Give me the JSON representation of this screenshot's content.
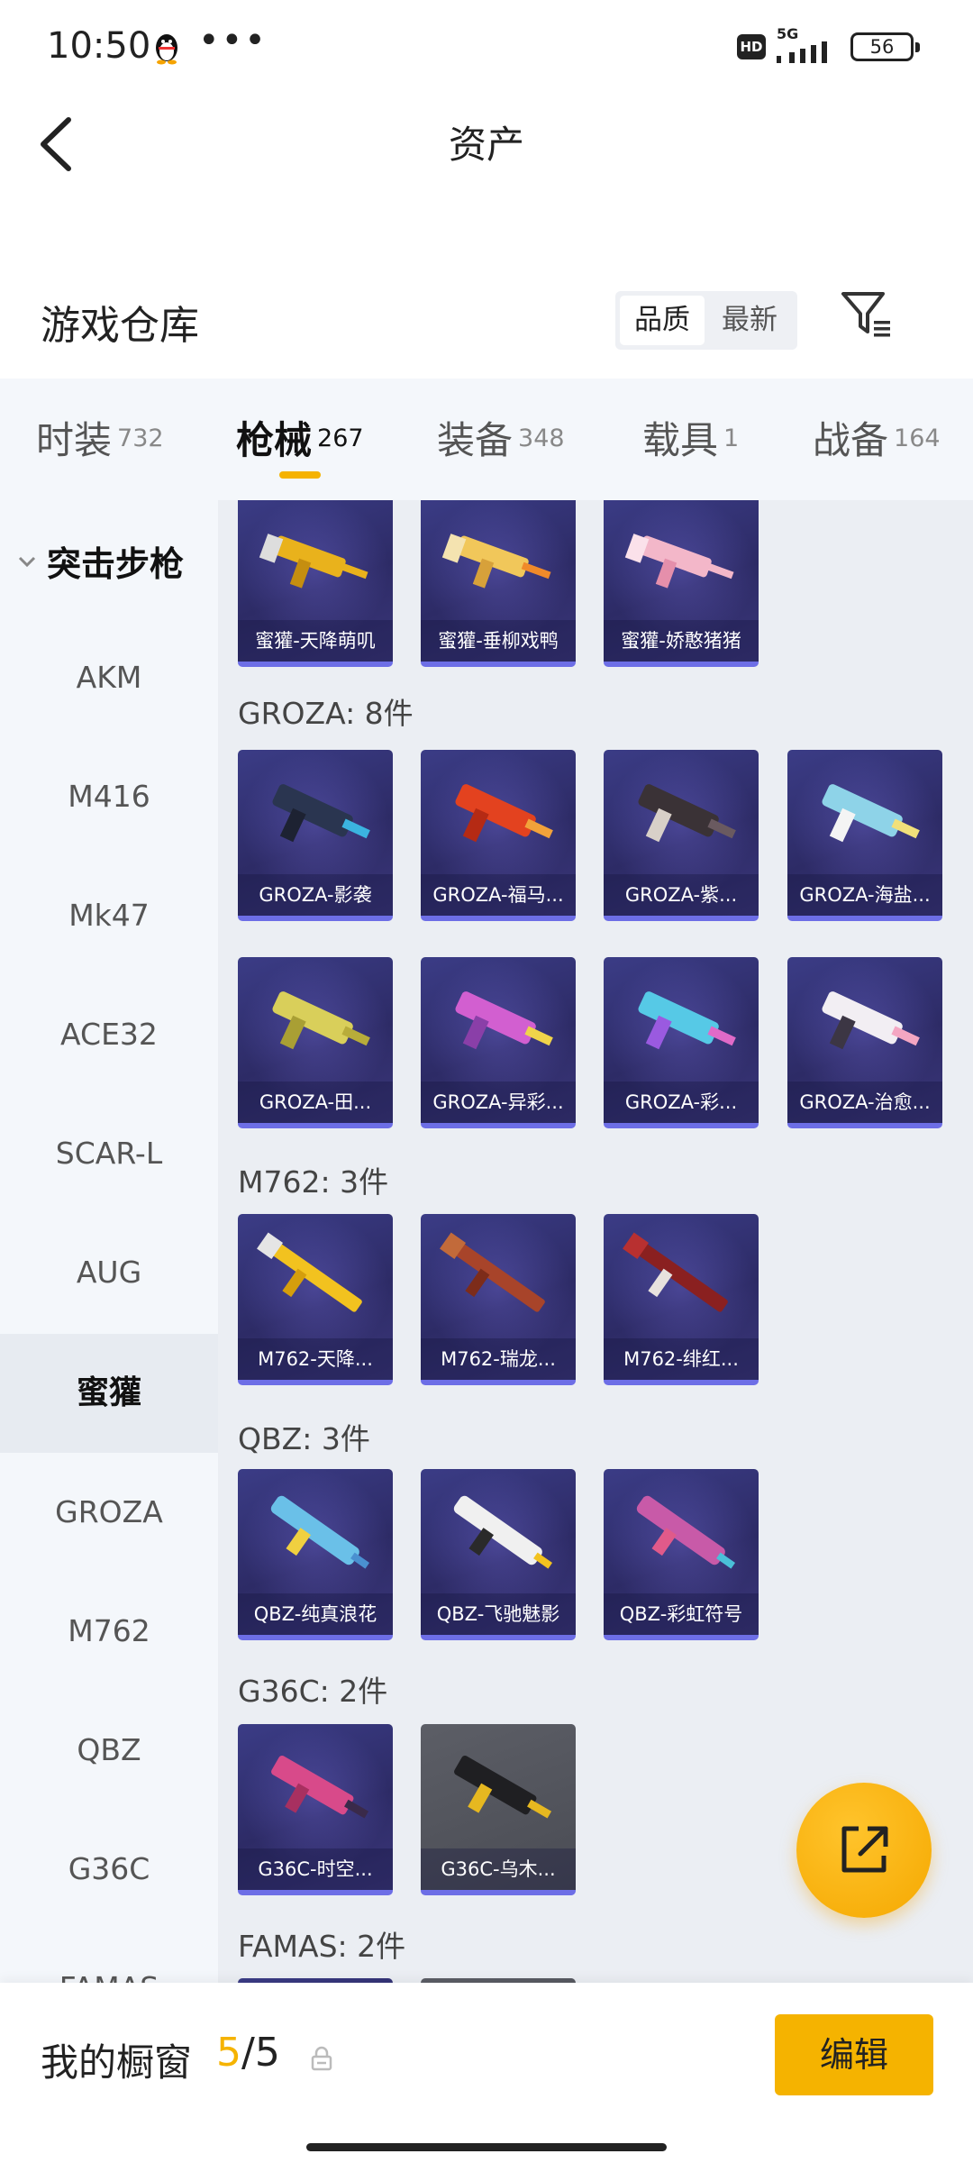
{
  "status_bar": {
    "time": "10:50",
    "hd": "HD",
    "network": "5G",
    "battery": "56"
  },
  "nav": {
    "title": "资产"
  },
  "warehouse": {
    "title": "游戏仓库",
    "sort_quality": "品质",
    "sort_newest": "最新"
  },
  "tabs": [
    {
      "label": "时装",
      "count": "732"
    },
    {
      "label": "枪械",
      "count": "267"
    },
    {
      "label": "装备",
      "count": "348"
    },
    {
      "label": "载具",
      "count": "1"
    },
    {
      "label": "战备",
      "count": "164"
    }
  ],
  "active_tab": "枪械",
  "sidebar": {
    "group": "突击步枪",
    "items": [
      "AKM",
      "M416",
      "Mk47",
      "ACE32",
      "SCAR-L",
      "AUG",
      "蜜獾",
      "GROZA",
      "M762",
      "QBZ",
      "G36C",
      "FAMAS"
    ],
    "active": "蜜獾"
  },
  "sections": {
    "honeybadger_cards": [
      "蜜獾-天降萌叽",
      "蜜獾-垂柳戏鸭",
      "蜜獾-娇憨猪猪"
    ],
    "groza": {
      "label": "GROZA: 8件",
      "cards": [
        "GROZA-影袭",
        "GROZA-福马...",
        "GROZA-紫...",
        "GROZA-海盐...",
        "GROZA-田...",
        "GROZA-异彩...",
        "GROZA-彩...",
        "GROZA-治愈..."
      ]
    },
    "m762": {
      "label": "M762: 3件",
      "cards": [
        "M762-天降...",
        "M762-瑞龙...",
        "M762-绯红..."
      ]
    },
    "qbz": {
      "label": "QBZ: 3件",
      "cards": [
        "QBZ-纯真浪花",
        "QBZ-飞驰魅影",
        "QBZ-彩虹符号"
      ]
    },
    "g36c": {
      "label": "G36C: 2件",
      "cards": [
        "G36C-时空...",
        "G36C-乌木..."
      ]
    },
    "famas": {
      "label": "FAMAS: 2件"
    }
  },
  "bottom_bar": {
    "label": "我的橱窗",
    "current": "5",
    "total": "/5",
    "edit": "编辑"
  },
  "colors": {
    "accent": "#f5b300",
    "card_bg": "#2d2b66",
    "card_border": "#6d6ee6"
  },
  "icons": [
    "qq-penguin-icon",
    "back-arrow-icon",
    "filter-icon",
    "chevron-down-icon",
    "lock-icon",
    "share-export-icon"
  ]
}
